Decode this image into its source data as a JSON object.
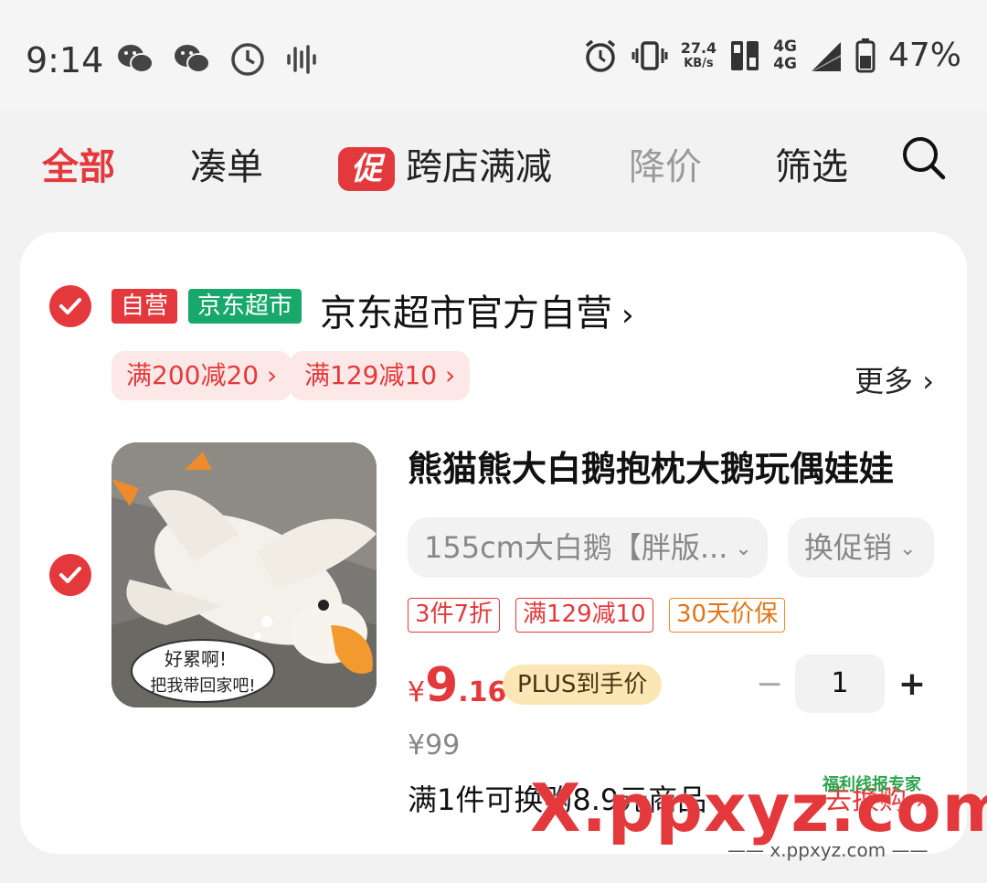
{
  "status_bar": {
    "time": "9:14",
    "net_speed_value": "27.4",
    "net_speed_unit": "KB/s",
    "network_1": "4G",
    "network_2": "4G",
    "battery": "47%"
  },
  "tabs": [
    {
      "label": "全部",
      "active": true
    },
    {
      "label": "凑单",
      "active": false
    },
    {
      "label": "跨店满减",
      "badge": "促",
      "active": false
    },
    {
      "label": "降价",
      "active": false
    },
    {
      "label": "筛选",
      "active": false
    }
  ],
  "shop": {
    "tag_self_operated": "自营",
    "tag_supermarket": "京东超市",
    "name": "京东超市官方自营",
    "coupons": [
      "满200减20",
      "满129减10"
    ],
    "more_label": "更多"
  },
  "product": {
    "title": "熊猫熊大白鹅抱枕大鹅玩偶娃娃",
    "spec": "155cm大白鹅【胖版...",
    "promo_select": "换促销",
    "promo_tags": [
      "3件7折",
      "满129减10",
      "30天价保"
    ],
    "price_currency": "¥",
    "price_integer": "9",
    "price_decimal": ".16",
    "plus_label": "PLUS到手价",
    "original_price": "¥99",
    "quantity": "1",
    "exchange_text": "满1件可换购8.9元商品",
    "exchange_link": "去换购",
    "image_caption_1": "好累啊!",
    "image_caption_2": "把我带回家吧!"
  },
  "watermark": {
    "brand": "X.ppxyz.com",
    "tagline": "福利线报专家",
    "url": "—— x.ppxyz.com ——"
  },
  "colors": {
    "accent": "#e4393c",
    "supermarket_green": "#18a86b",
    "plus_gold": "#fbe7b6"
  }
}
